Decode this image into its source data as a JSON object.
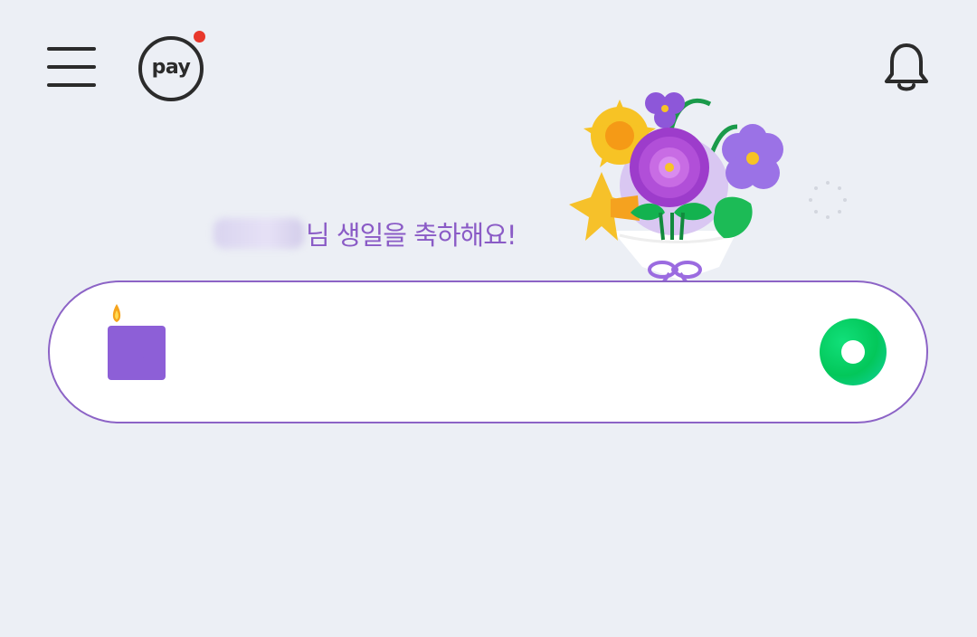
{
  "header": {
    "menu_icon": "hamburger-menu-icon",
    "pay_label": "pay",
    "pay_badge_color": "#e8382c",
    "bell_icon": "bell-icon"
  },
  "greeting": {
    "text": "님 생일을 축하해요!",
    "color": "#8a5bc6"
  },
  "search": {
    "placeholder": "",
    "logo_icon": "naver-birthday-candle-logo-icon",
    "green_dot_icon": "green-dot-icon",
    "border_color": "#8c63c6"
  }
}
